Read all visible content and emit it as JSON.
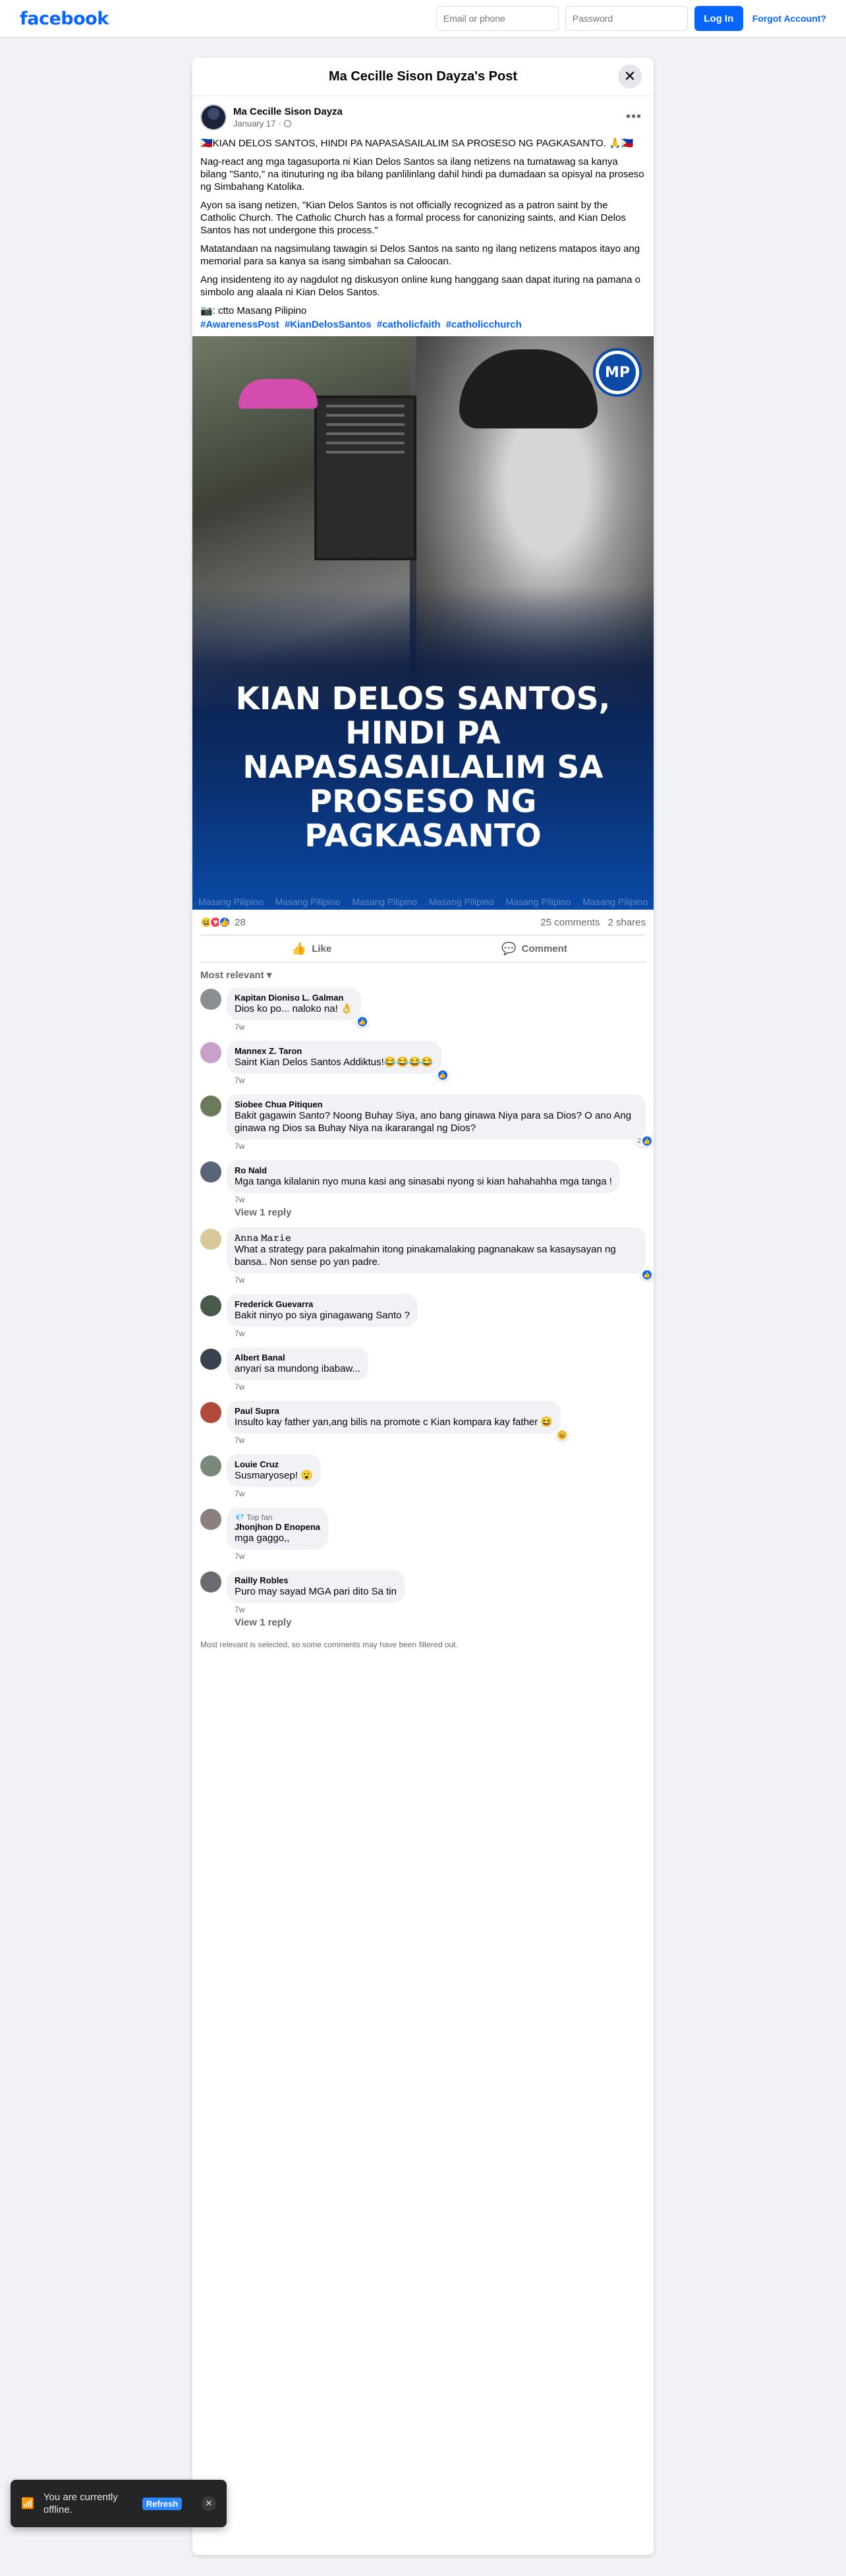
{
  "topbar": {
    "logo": "facebook",
    "email_placeholder": "Email or phone",
    "password_placeholder": "Password",
    "login_label": "Log In",
    "forgot_label": "Forgot Account?"
  },
  "dialog": {
    "title": "Ma Cecille Sison Dayza's Post",
    "close_icon": "close-icon"
  },
  "post": {
    "author": "Ma Cecille Sison Dayza",
    "date": "January 17",
    "audience_icon": "globe-icon",
    "paragraphs": [
      "🇵🇭KIAN DELOS SANTOS, HINDI PA NAPASASAILALIM SA PROSESO NG PAGKASANTO. 🙏🇵🇭",
      "Nag-react ang mga tagasuporta ni Kian Delos Santos sa ilang netizens na tumatawag sa kanya bilang \"Santo,\" na itinuturing ng iba bilang panlilinlang dahil hindi pa dumadaan sa opisyal na proseso ng Simbahang Katolika.",
      "Ayon sa isang netizen, \"Kian Delos Santos is not officially recognized as a patron saint by the Catholic Church. The Catholic Church has a formal process for canonizing saints, and Kian Delos Santos has not undergone this process.\"",
      "Matatandaan na nagsimulang tawagin si Delos Santos na santo ng ilang netizens matapos itayo ang memorial para sa kanya sa isang simbahan sa Caloocan.",
      "Ang insidenteng ito ay nagdulot ng diskusyon online kung hanggang saan dapat ituring na pamana o simbolo ang alaala ni Kian Delos Santos.",
      "📷: ctto Masang Pilipino"
    ],
    "hashtags": [
      "#AwarenessPost",
      "#KianDelosSantos",
      "#catholicfaith",
      "#catholicchurch"
    ],
    "image": {
      "logo_text": "MP",
      "headline": [
        "KIAN DELOS SANTOS,",
        "HINDI PA",
        "NAPASASAILALIM SA",
        "PROSESO NG",
        "PAGKASANTO"
      ],
      "watermark": "Masang Pilipino"
    }
  },
  "stats": {
    "reactions_icons": [
      "haha",
      "love",
      "like"
    ],
    "reaction_count": "28",
    "comments": "25 comments",
    "shares": "2 shares"
  },
  "actions": {
    "like_label": "Like",
    "comment_label": "Comment"
  },
  "sort_label": "Most relevant ▾",
  "comments": [
    {
      "name": "Kapitan Dioniso L. Galman",
      "text": "Dios ko po... naloko na! 👌",
      "time": "7w",
      "react": "like",
      "count": "",
      "color": "#8a8d91"
    },
    {
      "name": "Mannex Z. Taron",
      "text": "Saint Kian Delos Santos Addiktus!😂😂😂😂",
      "time": "7w",
      "react": "like",
      "count": "",
      "color": "#c8a0c8"
    },
    {
      "name": "Siobee Chua Pitiquen",
      "text": "Bakit gagawin Santo? Noong Buhay Siya, ano bang ginawa Niya para sa Dios? O ano Ang ginawa ng Dios sa Buhay Niya na ikararangal ng Dios?",
      "time": "7w",
      "react": "like",
      "count": "2",
      "color": "#6a7a5a"
    },
    {
      "name": "Ro Nald",
      "text": "Mga tanga kilalanin nyo muna kasi ang sinasabi nyong si kian hahahahha mga tanga !",
      "time": "7w",
      "react": "",
      "count": "",
      "color": "#5a6478"
    },
    {
      "name": "𝙰𝚗𝚗𝚊 𝙼𝚊𝚛𝚒𝚎",
      "text": "What a strategy para pakalmahin itong pinakamalaking pagnanakaw sa kasaysayan ng bansa.. Non sense po yan padre.",
      "time": "7w",
      "react": "like",
      "count": "",
      "color": "#d8c89a"
    },
    {
      "name": "Frederick Guevarra",
      "text": "Bakit ninyo po siya ginagawang Santo ?",
      "time": "7w",
      "react": "",
      "count": "",
      "color": "#4a5a4a"
    },
    {
      "name": "Albert Banal",
      "text": "anyari sa mundong ibabaw...",
      "time": "7w",
      "react": "",
      "count": "",
      "color": "#3a4250"
    },
    {
      "name": "Paul Supra",
      "text": "Insulto kay father yan,ang bilis na promote c Kian kompara kay father 😆",
      "time": "7w",
      "react": "haha",
      "count": "",
      "color": "#b04a3a"
    },
    {
      "name": "Louie Cruz",
      "text": "Susmaryosep! 😮",
      "time": "7w",
      "react": "",
      "count": "",
      "color": "#7a8a7a"
    },
    {
      "name": "Jhonjhon D Enopena",
      "badge": "💎 Top fan",
      "text": "mga gaggo,,",
      "time": "7w",
      "react": "",
      "count": "",
      "color": "#8a8080"
    },
    {
      "name": "Railly Robles",
      "text": "Puro may sayad MGA pari dito Sa tin",
      "time": "7w",
      "react": "",
      "count": "",
      "color": "#6a6a70"
    }
  ],
  "view_reply_label": "View 1 reply",
  "footnote": "Most relevant is selected, so some comments may have been filtered out.",
  "toast": {
    "text": "You are currently offline.",
    "refresh_label": "Refresh",
    "icon": "wifi-off-icon"
  }
}
